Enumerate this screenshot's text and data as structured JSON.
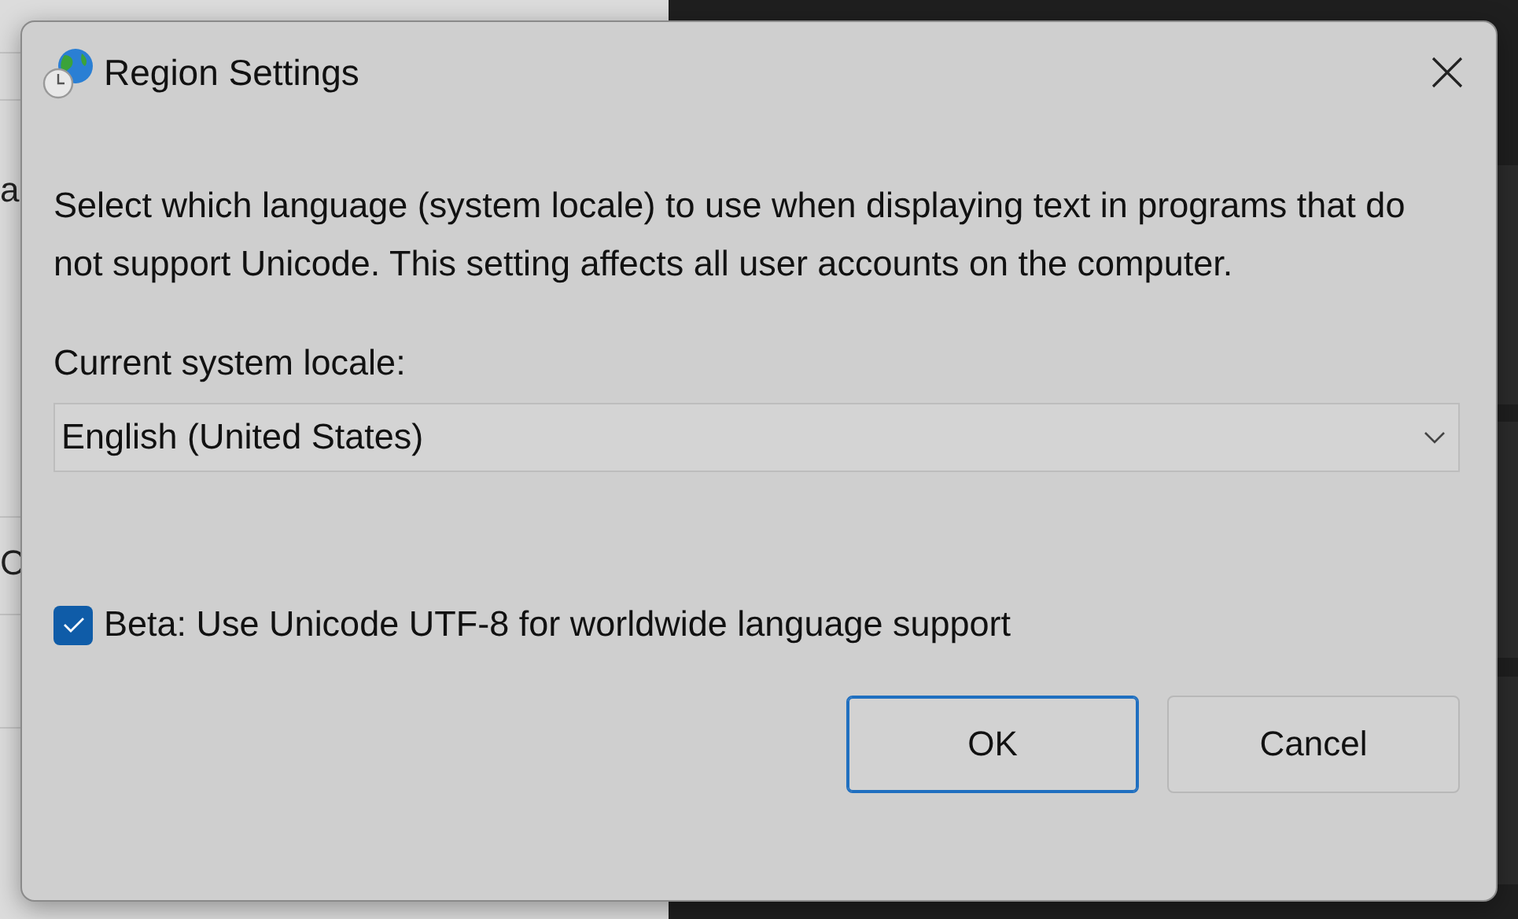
{
  "background": {
    "left_fragments": [
      "a",
      "C"
    ]
  },
  "window": {
    "title": "Region Settings"
  },
  "description": "Select which language (system locale) to use when displaying text in programs that do not support Unicode. This setting affects all user accounts on the computer.",
  "locale": {
    "label": "Current system locale:",
    "value": "English (United States)"
  },
  "beta_option": {
    "label": "Beta: Use Unicode UTF-8 for worldwide language support",
    "checked": true
  },
  "buttons": [
    {
      "label": "OK",
      "default": true
    },
    {
      "label": "Cancel",
      "default": false
    }
  ]
}
